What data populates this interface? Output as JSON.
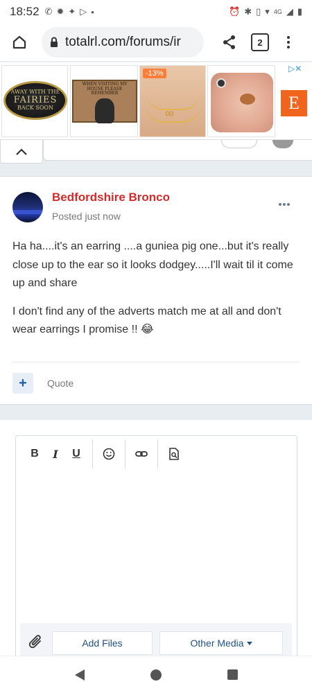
{
  "status_bar": {
    "time": "18:52",
    "network": "4G"
  },
  "browser": {
    "url": "totalrl.com/forums/ir",
    "tab_count": "2"
  },
  "ad": {
    "ad1_text_top": "AWAY WITH THE",
    "ad1_text_main": "FAIRIES",
    "ad1_text_bottom": "BACK SOON",
    "ad2_text": "WHEN VISITING MY HOUSE PLEASE REMEMBER",
    "ad3_discount": "-13%",
    "etsy_letter": "E"
  },
  "post": {
    "author": "Bedfordshire Bronco",
    "posted": "Posted just now",
    "paragraph1": "Ha ha....it's an earring ....a guniea pig one...but it's really close up to the ear so it looks dodgey.....I'll wait til it come up and share",
    "paragraph2": "I don't find any of the adverts match me at all and don't wear earrings I promise !! 😂",
    "plus_label": "+",
    "quote_label": "Quote"
  },
  "editor": {
    "bold": "B",
    "italic": "I",
    "underline": "U",
    "add_files": "Add Files",
    "other_media": "Other Media"
  }
}
